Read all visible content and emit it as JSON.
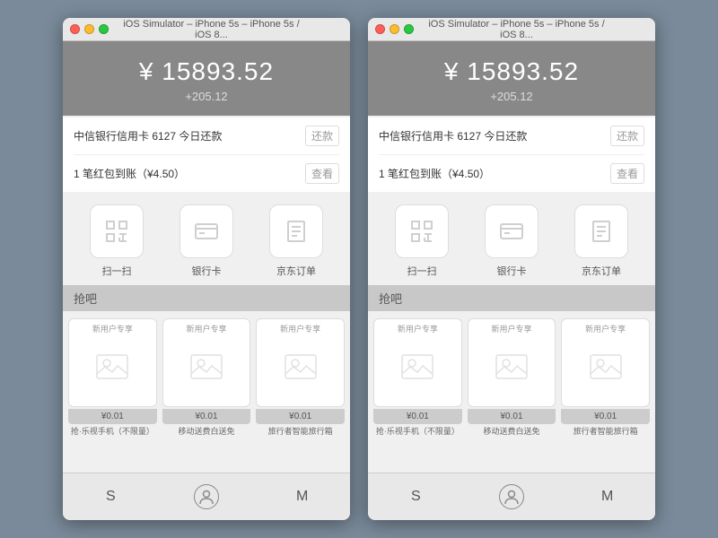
{
  "simulators": [
    {
      "title": "iOS Simulator – iPhone 5s – iPhone 5s / iOS 8...",
      "balance": {
        "amount": "¥ 15893.52",
        "change": "+205.12"
      },
      "notifications": [
        {
          "text": "中信银行信用卡 6127 今日还款",
          "action": "还款"
        },
        {
          "text": "1 笔红包到账（¥4.50）",
          "action": "查看"
        }
      ],
      "icons": [
        {
          "label": "扫一扫"
        },
        {
          "label": "银行卡"
        },
        {
          "label": "京东订单"
        }
      ],
      "section_label": "抢吧",
      "cards": [
        {
          "top_label": "新用户专享",
          "title": "抢·乐视手机（不限量）",
          "price": "¥0.01"
        },
        {
          "top_label": "新用户专享",
          "title": "移动送费白送免",
          "price": "¥0.01"
        },
        {
          "top_label": "新用户专享",
          "title": "旅行者智能旅行箱",
          "price": "¥0.01"
        }
      ],
      "nav": [
        "S",
        "person",
        "M"
      ]
    },
    {
      "title": "iOS Simulator – iPhone 5s – iPhone 5s / iOS 8...",
      "balance": {
        "amount": "¥ 15893.52",
        "change": "+205.12"
      },
      "notifications": [
        {
          "text": "中信银行信用卡 6127 今日还款",
          "action": "还款"
        },
        {
          "text": "1 笔红包到账（¥4.50）",
          "action": "查看"
        }
      ],
      "icons": [
        {
          "label": "扫一扫"
        },
        {
          "label": "银行卡"
        },
        {
          "label": "京东订单"
        }
      ],
      "section_label": "抢吧",
      "cards": [
        {
          "top_label": "新用户专享",
          "title": "抢·乐视手机（不限量）",
          "price": "¥0.01"
        },
        {
          "top_label": "新用户专享",
          "title": "移动送费白送免",
          "price": "¥0.01"
        },
        {
          "top_label": "新用户专享",
          "title": "旅行者智能旅行箱",
          "price": "¥0.01"
        }
      ],
      "nav": [
        "S",
        "person",
        "M"
      ]
    }
  ]
}
